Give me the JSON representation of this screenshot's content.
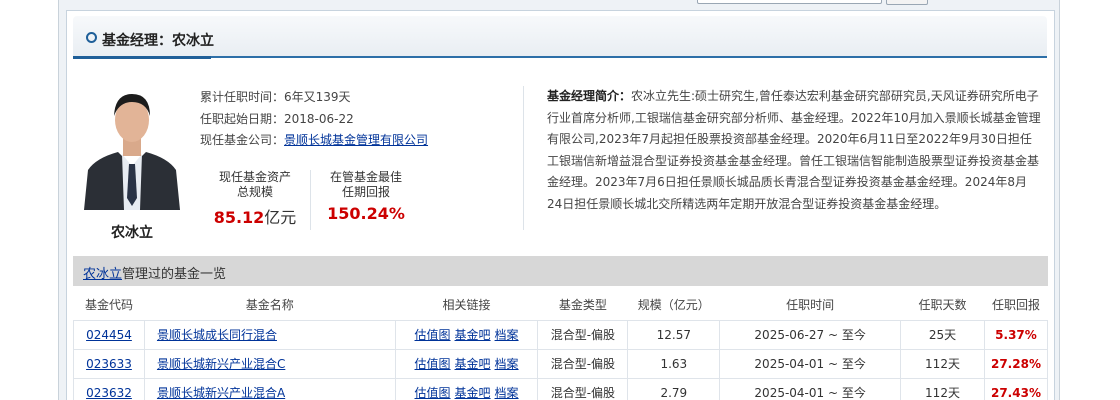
{
  "header": {
    "title": "基金经理：农冰立"
  },
  "manager": {
    "name": "农冰立",
    "tenure_label": "累计任职时间：",
    "tenure_value": "6年又139天",
    "start_label": "任职起始日期：",
    "start_value": "2018-06-22",
    "company_label": "现任基金公司：",
    "company_value": "景顺长城基金管理有限公司"
  },
  "stats": {
    "assets_label_1": "现任基金资产",
    "assets_label_2": "总规模",
    "assets_value": "85.12",
    "assets_unit": "亿元",
    "best_label_1": "在管基金最佳",
    "best_label_2": "任期回报",
    "best_value": "150.24%"
  },
  "bio": {
    "label": "基金经理简介：",
    "text": "农冰立先生:硕士研究生,曾任泰达宏利基金研究部研究员,天风证券研究所电子行业首席分析师,工银瑞信基金研究部分析师、基金经理。2022年10月加入景顺长城基金管理有限公司,2023年7月起担任股票投资部基金经理。2020年6月11日至2022年9月30日担任工银瑞信新增益混合型证券投资基金基金经理。曾任工银瑞信智能制造股票型证券投资基金基金经理。2023年7月6日担任景顺长城品质长青混合型证券投资基金基金经理。2024年8月24日担任景顺长城北交所精选两年定期开放混合型证券投资基金基金经理。"
  },
  "fund_list": {
    "title_link": "农冰立",
    "title_rest": "管理过的基金一览",
    "columns": [
      "基金代码",
      "基金名称",
      "相关链接",
      "基金类型",
      "规模（亿元）",
      "任职时间",
      "任职天数",
      "任职回报"
    ],
    "rows": [
      {
        "code": "024454",
        "name": "景顺长城成长同行混合",
        "links": [
          "估值图",
          "基金吧",
          "档案"
        ],
        "type": "混合型-偏股",
        "scale": "12.57",
        "period": "2025-06-27 ~ 至今",
        "days": "25天",
        "ret": "5.37%"
      },
      {
        "code": "023633",
        "name": "景顺长城新兴产业混合C",
        "links": [
          "估值图",
          "基金吧",
          "档案"
        ],
        "type": "混合型-偏股",
        "scale": "1.63",
        "period": "2025-04-01 ~ 至今",
        "days": "112天",
        "ret": "27.28%"
      },
      {
        "code": "023632",
        "name": "景顺长城新兴产业混合A",
        "links": [
          "估值图",
          "基金吧",
          "档案"
        ],
        "type": "混合型-偏股",
        "scale": "2.79",
        "period": "2025-04-01 ~ 至今",
        "days": "112天",
        "ret": "27.43%"
      }
    ]
  }
}
